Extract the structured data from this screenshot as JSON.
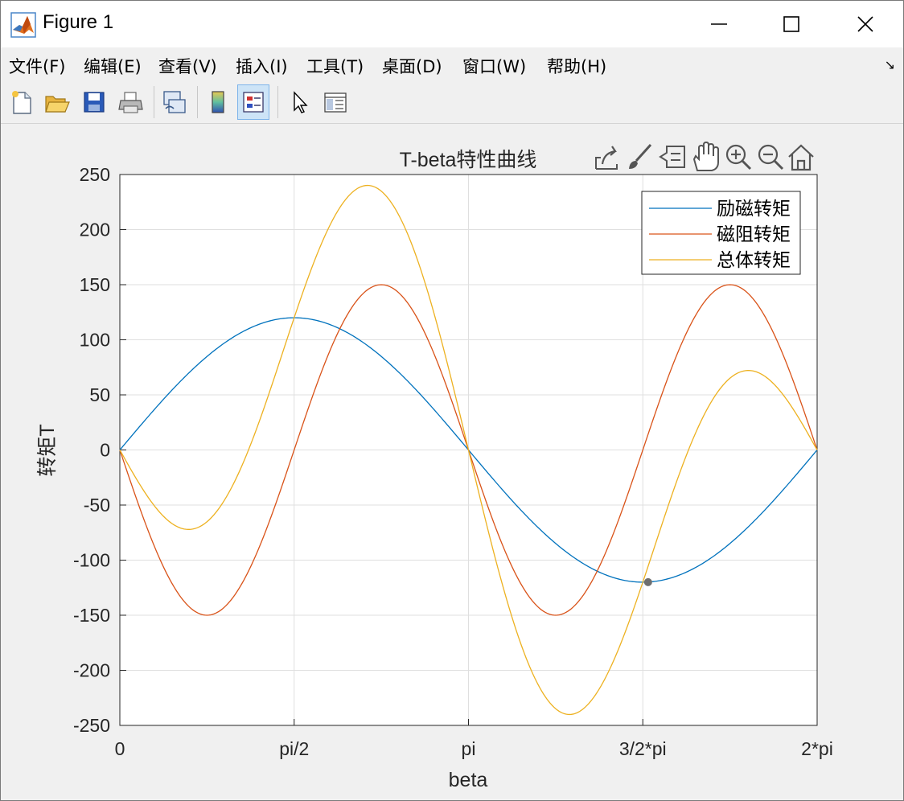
{
  "window": {
    "title": "Figure 1"
  },
  "menu": {
    "items": [
      "文件(F)",
      "编辑(E)",
      "查看(V)",
      "插入(I)",
      "工具(T)",
      "桌面(D)",
      "窗口(W)",
      "帮助(H)"
    ]
  },
  "toolbar": {
    "icons": [
      "new-figure-icon",
      "open-file-icon",
      "save-icon",
      "print-icon",
      "link-plot-icon",
      "colorbar-icon",
      "legend-icon",
      "edit-plot-icon",
      "property-inspector-icon"
    ]
  },
  "axes_toolbar": {
    "icons": [
      "export-icon",
      "brush-icon",
      "data-tips-icon",
      "pan-icon",
      "zoom-in-icon",
      "zoom-out-icon",
      "home-icon"
    ]
  },
  "chart_data": {
    "type": "line",
    "title": "T-beta特性曲线",
    "xlabel": "beta",
    "ylabel": "转矩T",
    "xlim": [
      0,
      6.283185307
    ],
    "ylim": [
      -250,
      250
    ],
    "xticks": [
      0,
      1.570796327,
      3.141592654,
      4.71238898,
      6.283185307
    ],
    "xtick_labels": [
      "0",
      "pi/2",
      "pi",
      "3/2*pi",
      "2*pi"
    ],
    "yticks": [
      250,
      200,
      150,
      100,
      50,
      0,
      -50,
      -100,
      -150,
      -200,
      -250
    ],
    "ytick_labels": [
      "250",
      "200",
      "150",
      "100",
      "50",
      "0",
      "-50",
      "-100",
      "-150",
      "-200",
      "-250"
    ],
    "grid": true,
    "legend_position": "top-right",
    "marker": {
      "x": 4.76,
      "y": -120
    },
    "x_samples": [
      0,
      0.3927,
      0.7854,
      1.1781,
      1.5708,
      1.9635,
      2.3562,
      2.7489,
      3.1416,
      3.5343,
      3.927,
      4.3197,
      4.7124,
      5.1051,
      5.4978,
      5.8905,
      6.2832
    ],
    "series": [
      {
        "name": "励磁转矩",
        "color": "#0072bd",
        "equation": "120*sin(beta)",
        "values": [
          0,
          45.9,
          84.9,
          110.9,
          120,
          110.9,
          84.9,
          45.9,
          0,
          -45.9,
          -84.9,
          -110.9,
          -120,
          -110.9,
          -84.9,
          -45.9,
          0
        ]
      },
      {
        "name": "磁阻转矩",
        "color": "#d95319",
        "equation": "-150*sin(2*beta)",
        "values": [
          0,
          -106.1,
          -150,
          -106.1,
          0,
          106.1,
          150,
          106.1,
          0,
          -106.1,
          -150,
          -106.1,
          0,
          106.1,
          150,
          106.1,
          0
        ]
      },
      {
        "name": "总体转矩",
        "color": "#edb120",
        "equation": "120*sin(beta)-150*sin(2*beta)",
        "values": [
          0,
          -60.2,
          -65.1,
          4.8,
          120,
          217,
          234.9,
          152,
          0,
          -152,
          -234.9,
          -217,
          -120,
          -4.8,
          65.1,
          60.2,
          0
        ]
      }
    ]
  }
}
